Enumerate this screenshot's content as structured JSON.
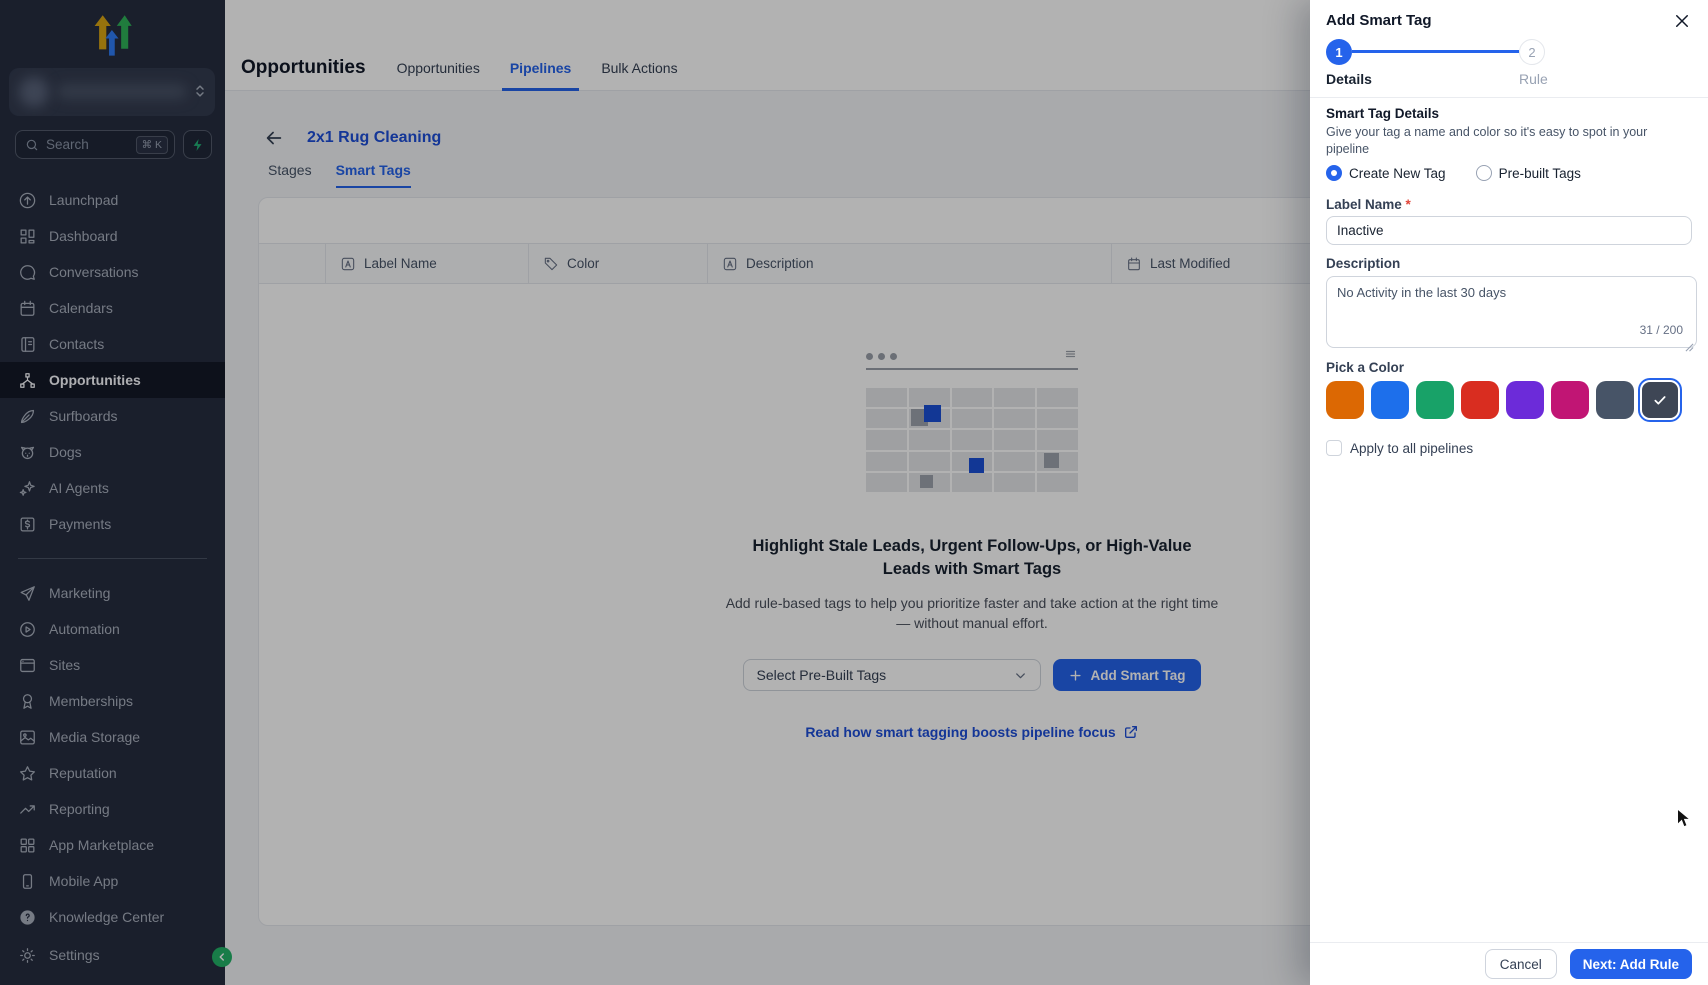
{
  "colors": {
    "accent": "#2563EB",
    "link_blue": "#1D4ED8",
    "sidebar_bg": "#262D40",
    "overlay": "rgba(0,0,0,0.30)",
    "logo": {
      "gold": "#D9A514",
      "blue": "#2E7CF6",
      "green": "#2EB258"
    }
  },
  "sidebar": {
    "search": {
      "placeholder": "Search",
      "shortcut": "⌘ K"
    },
    "items": [
      {
        "label": "Launchpad",
        "icon": "launchpad-icon"
      },
      {
        "label": "Dashboard",
        "icon": "dashboard-icon"
      },
      {
        "label": "Conversations",
        "icon": "conversations-icon"
      },
      {
        "label": "Calendars",
        "icon": "calendars-icon"
      },
      {
        "label": "Contacts",
        "icon": "contacts-icon"
      },
      {
        "label": "Opportunities",
        "icon": "opportunities-icon",
        "active": true
      },
      {
        "label": "Surfboards",
        "icon": "surfboards-icon"
      },
      {
        "label": "Dogs",
        "icon": "dogs-icon"
      },
      {
        "label": "AI Agents",
        "icon": "ai-agents-icon"
      },
      {
        "label": "Payments",
        "icon": "payments-icon"
      },
      {
        "label": "Marketing",
        "icon": "marketing-icon"
      },
      {
        "label": "Automation",
        "icon": "automation-icon"
      },
      {
        "label": "Sites",
        "icon": "sites-icon"
      },
      {
        "label": "Memberships",
        "icon": "memberships-icon"
      },
      {
        "label": "Media Storage",
        "icon": "media-storage-icon"
      },
      {
        "label": "Reputation",
        "icon": "reputation-icon"
      },
      {
        "label": "Reporting",
        "icon": "reporting-icon"
      },
      {
        "label": "App Marketplace",
        "icon": "app-marketplace-icon"
      },
      {
        "label": "Mobile App",
        "icon": "mobile-app-icon"
      },
      {
        "label": "Knowledge Center",
        "icon": "knowledge-center-icon"
      }
    ],
    "settings_label": "Settings"
  },
  "header": {
    "title": "Opportunities",
    "tabs": [
      {
        "label": "Opportunities",
        "active": false
      },
      {
        "label": "Pipelines",
        "active": true
      },
      {
        "label": "Bulk Actions",
        "active": false
      }
    ]
  },
  "pipeline": {
    "name": "2x1 Rug Cleaning",
    "tabs": [
      {
        "label": "Stages",
        "active": false
      },
      {
        "label": "Smart Tags",
        "active": true
      }
    ]
  },
  "table": {
    "columns": [
      {
        "label": "Label Name",
        "icon": "letter-a-icon"
      },
      {
        "label": "Color",
        "icon": "tag-icon"
      },
      {
        "label": "Description",
        "icon": "letter-a-icon"
      },
      {
        "label": "Last Modified",
        "icon": "calendar-icon"
      }
    ]
  },
  "empty_state": {
    "title_line1": "Highlight Stale Leads, Urgent Follow-Ups, or High-Value",
    "title_line2": "Leads with Smart Tags",
    "description": "Add rule-based tags to help you prioritize faster and take action at the right time — without manual effort.",
    "select_label": "Select Pre-Built Tags",
    "add_button": "Add Smart Tag",
    "link": "Read how smart tagging boosts pipeline focus"
  },
  "drawer": {
    "title": "Add Smart Tag",
    "steps": [
      {
        "num": "1",
        "label": "Details"
      },
      {
        "num": "2",
        "label": "Rule"
      }
    ],
    "section_title": "Smart Tag Details",
    "section_description": "Give your tag a name and color so it's easy to spot in your pipeline",
    "radio_options": [
      {
        "label": "Create New Tag",
        "selected": true
      },
      {
        "label": "Pre-built Tags",
        "selected": false
      }
    ],
    "label_name": {
      "label": "Label Name",
      "required": "*",
      "value": "Inactive"
    },
    "description": {
      "label": "Description",
      "value": "No Activity in the last 30 days",
      "counter": "31 / 200"
    },
    "color": {
      "label": "Pick a Color",
      "swatches": [
        "#DC6803",
        "#1D6FEB",
        "#18A268",
        "#D92D20",
        "#6C2BD9",
        "#C11574",
        "#475467",
        "#3E4655"
      ],
      "selected_index": 7
    },
    "checkbox_label": "Apply to all pipelines",
    "footer": {
      "cancel": "Cancel",
      "next": "Next: Add Rule"
    }
  }
}
